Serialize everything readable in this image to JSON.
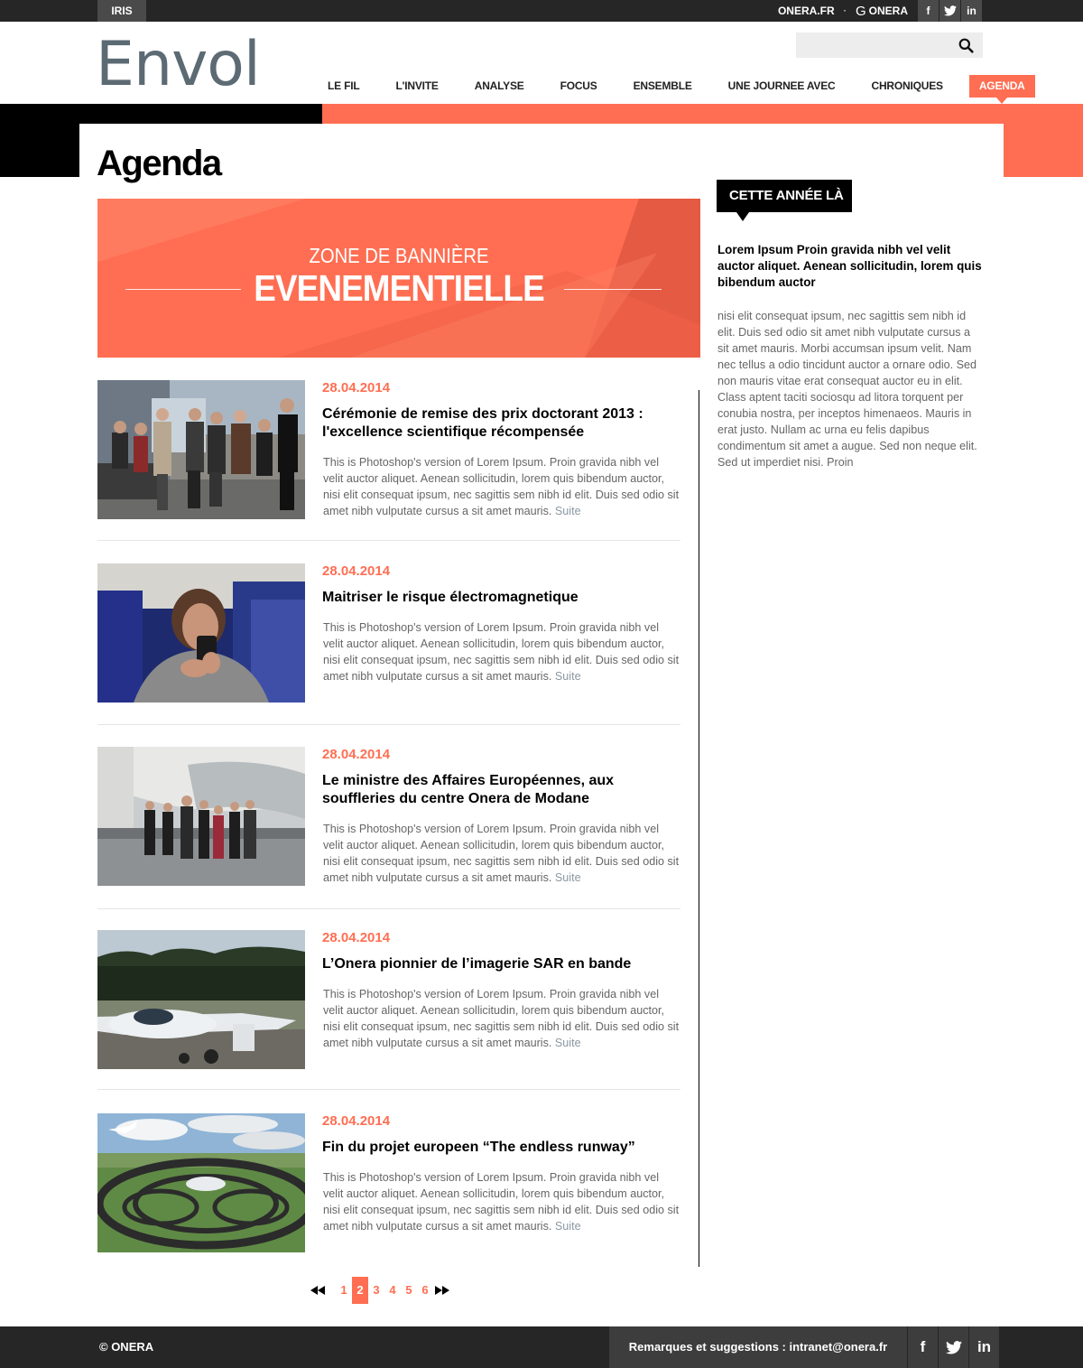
{
  "topbar": {
    "site_tag": "IRIS",
    "link_onera_fr": "ONERA.FR",
    "separator": "·",
    "link_onera_g": "G",
    "link_onera": "ONERA",
    "social": {
      "facebook": "f",
      "twitter": "t",
      "linkedin": "in"
    }
  },
  "header": {
    "logo": "Envol",
    "search": {
      "value": "",
      "placeholder": ""
    },
    "nav": [
      {
        "label": "LE FIL",
        "active": false
      },
      {
        "label": "L'INVITE",
        "active": false
      },
      {
        "label": "ANALYSE",
        "active": false
      },
      {
        "label": "FOCUS",
        "active": false
      },
      {
        "label": "ENSEMBLE",
        "active": false
      },
      {
        "label": "UNE JOURNEE AVEC",
        "active": false
      },
      {
        "label": "CHRONIQUES",
        "active": false
      },
      {
        "label": "AGENDA",
        "active": true
      }
    ]
  },
  "page": {
    "title": "Agenda"
  },
  "banner": {
    "line1": "ZONE DE BANNIÈRE",
    "line2": "EVENEMENTIELLE"
  },
  "articles": [
    {
      "date": "28.04.2014",
      "title": "Cérémonie de remise des prix doctorant 2013 : l'excellence scientifique récompensée",
      "excerpt": "This is Photoshop's version  of Lorem Ipsum. Proin gravida nibh vel velit auctor aliquet. Aenean sollicitudin, lorem quis bibendum auctor, nisi elit consequat ipsum, nec sagittis sem nibh id elit. Duis sed odio sit amet nibh vulputate cursus a sit amet mauris.",
      "more": "Suite",
      "image": "award-ceremony-photo"
    },
    {
      "date": "28.04.2014",
      "title": "Maitriser le risque électromagnetique",
      "excerpt": "This is Photoshop's version  of Lorem Ipsum. Proin gravida nibh vel velit auctor aliquet. Aenean sollicitudin, lorem quis bibendum auctor, nisi elit consequat ipsum, nec sagittis sem nibh id elit. Duis sed odio sit amet nibh vulputate cursus a sit amet mauris.",
      "more": "Suite",
      "image": "woman-phone-airplane-photo"
    },
    {
      "date": "28.04.2014",
      "title": "Le ministre des Affaires Européennes, aux souffleries du centre Onera de Modane",
      "excerpt": "This is Photoshop's version  of Lorem Ipsum. Proin gravida nibh vel velit auctor aliquet. Aenean sollicitudin, lorem quis bibendum auctor, nisi elit consequat ipsum, nec sagittis sem nibh id elit. Duis sed odio sit amet nibh vulputate cursus a sit amet mauris.",
      "more": "Suite",
      "image": "wind-tunnel-visit-photo"
    },
    {
      "date": "28.04.2014",
      "title": "L’Onera pionnier de l’imagerie SAR en bande",
      "excerpt": "This is Photoshop's version  of Lorem Ipsum. Proin gravida nibh vel velit auctor aliquet. Aenean sollicitudin, lorem quis bibendum auctor, nisi elit consequat ipsum, nec sagittis sem nibh id elit. Duis sed odio sit amet nibh vulputate cursus a sit amet mauris.",
      "more": "Suite",
      "image": "glider-plane-photo"
    },
    {
      "date": "28.04.2014",
      "title": "Fin du projet europeen “The endless runway”",
      "excerpt": "This is Photoshop's version  of Lorem Ipsum. Proin gravida nibh vel velit auctor aliquet. Aenean sollicitudin, lorem quis bibendum auctor, nisi elit consequat ipsum, nec sagittis sem nibh id elit. Duis sed odio sit amet nibh vulputate cursus a sit amet mauris.",
      "more": "Suite",
      "image": "circular-runway-render"
    }
  ],
  "pagination": {
    "pages": [
      "1",
      "2",
      "3",
      "4",
      "5",
      "6"
    ],
    "current": "2"
  },
  "sidebar": {
    "tag": "CETTE ANNÉE LÀ",
    "lead": "Lorem Ipsum Proin gravida nibh vel velit auctor aliquet. Aenean sollicitudin, lorem quis bibendum auctor",
    "body": "nisi elit consequat ipsum, nec sagittis sem nibh id elit. Duis sed odio sit amet nibh vulputate cursus a sit amet mauris. Morbi accumsan ipsum velit. Nam nec tellus a odio tincidunt auctor a ornare odio. Sed non  mauris vitae erat consequat auctor eu in elit. Class aptent taciti sociosqu ad litora torquent per conubia nostra, per inceptos himenaeos. Mauris in erat justo. Nullam ac urna eu felis dapibus condimentum sit amet a augue. Sed non neque elit. Sed ut imperdiet nisi. Proin"
  },
  "footer": {
    "copyright": "© ONERA",
    "contact": "Remarques et suggestions : intranet@onera.fr",
    "social": {
      "facebook": "f",
      "twitter": "t",
      "linkedin": "in"
    }
  },
  "colors": {
    "accent": "#ff6e52",
    "dark": "#262626",
    "logo": "#5c6a73",
    "link": "#8a98a2"
  }
}
